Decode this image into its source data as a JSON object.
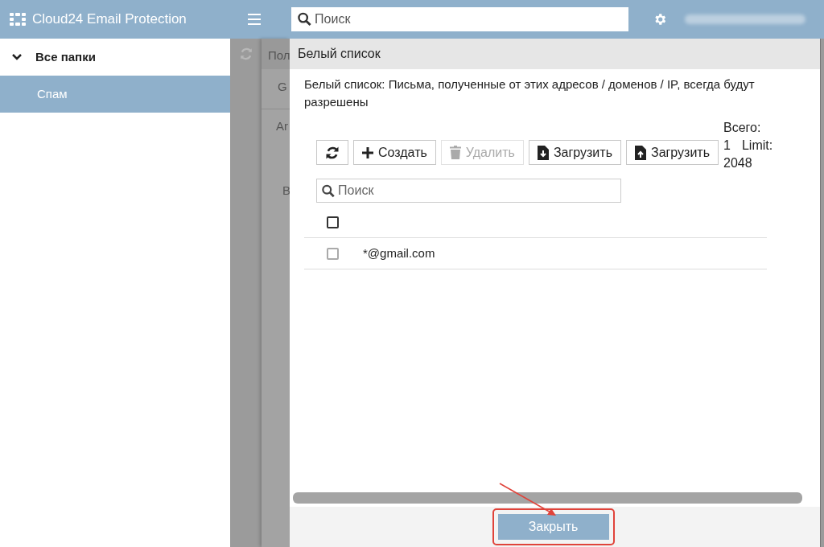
{
  "header": {
    "app_title": "Cloud24 Email Protection",
    "search": {
      "placeholder": "Поиск"
    }
  },
  "sidebar": {
    "items": [
      {
        "label": "Все папки",
        "kind": "group",
        "expanded": true,
        "selected": false
      },
      {
        "label": "Спам",
        "kind": "folder",
        "selected": true
      }
    ]
  },
  "background_panel": {
    "texts": [
      "Пол",
      "G",
      "Ar",
      "B"
    ]
  },
  "dialog": {
    "title": "Белый список",
    "description": "Белый список: Письма, полученные от этих адресов / доменов / IP, всегда будут разрешены",
    "toolbar": [
      {
        "kind": "refresh",
        "disabled": false
      },
      {
        "kind": "create",
        "label": "Создать",
        "disabled": false
      },
      {
        "kind": "delete",
        "label": "Удалить",
        "disabled": true
      },
      {
        "kind": "import",
        "label": "Загрузить",
        "disabled": false
      },
      {
        "kind": "export",
        "label": "Загрузить",
        "disabled": false
      }
    ],
    "totals": [
      "Всего:",
      "1",
      "Limit:",
      "2048"
    ],
    "search": {
      "placeholder": "Поиск"
    },
    "table": {
      "header_checked": false,
      "rows": [
        {
          "address": "*@gmail.com",
          "checked": false
        }
      ]
    },
    "close_button": "Закрыть"
  }
}
